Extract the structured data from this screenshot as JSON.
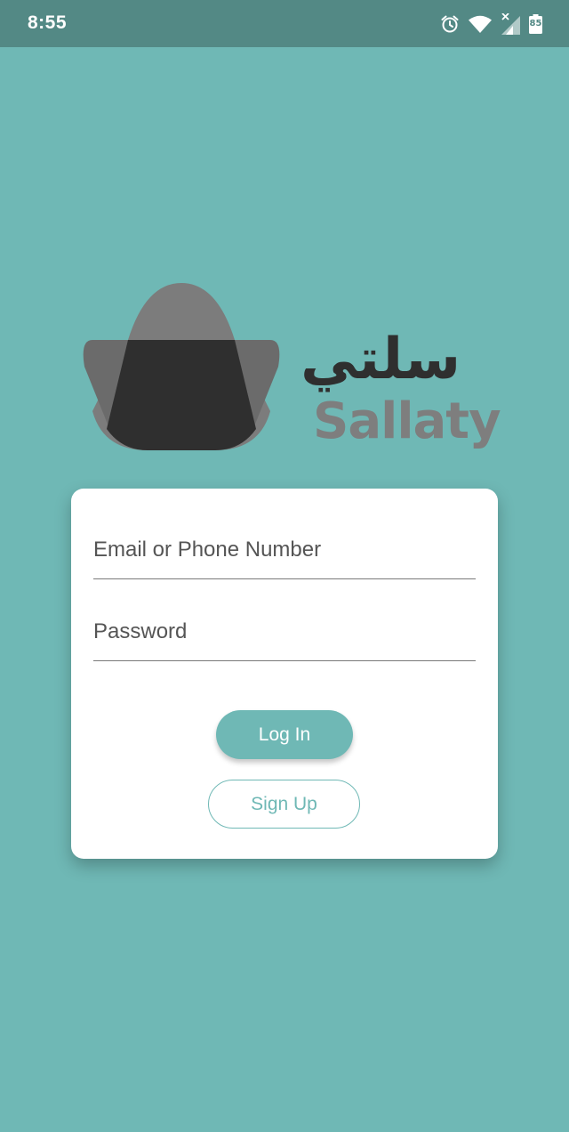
{
  "status_bar": {
    "time": "8:55",
    "battery_level": "85",
    "icons": [
      "alarm-icon",
      "wifi-icon",
      "signal-icon",
      "battery-icon"
    ]
  },
  "logo": {
    "arabic_name": "سلتي",
    "latin_name": "Sallaty"
  },
  "login_form": {
    "email_placeholder": "Email or Phone Number",
    "email_value": "",
    "password_placeholder": "Password",
    "password_value": "",
    "login_label": "Log In",
    "signup_label": "Sign Up"
  },
  "colors": {
    "background": "#6fb8b5",
    "status_bar": "#538985",
    "accent": "#6fb8b5",
    "card": "#ffffff"
  }
}
